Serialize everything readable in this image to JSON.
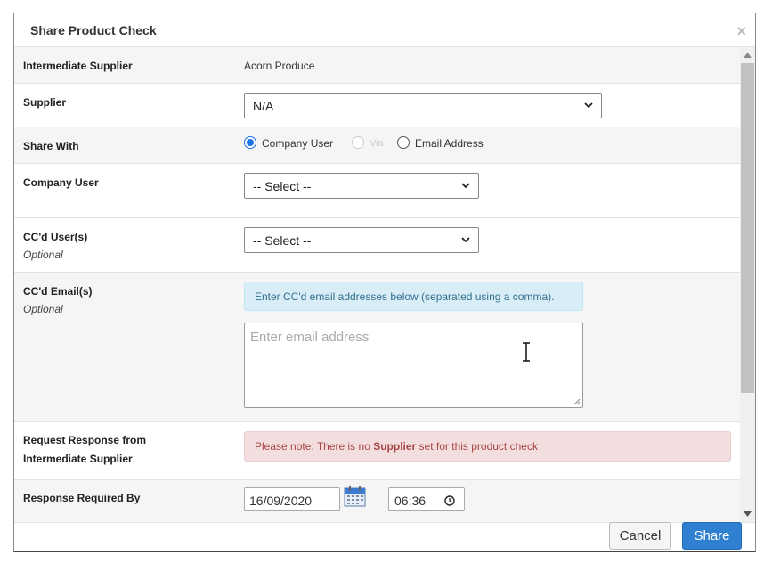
{
  "modal": {
    "title": "Share Product Check",
    "close_glyph": "×"
  },
  "rows": {
    "intermediate_supplier": {
      "label": "Intermediate Supplier",
      "value": "Acorn Produce"
    },
    "supplier": {
      "label": "Supplier",
      "selected": "N/A"
    },
    "share_with": {
      "label": "Share With",
      "options": [
        {
          "label": "Company User",
          "checked": true,
          "disabled": false
        },
        {
          "label": "Via",
          "checked": false,
          "disabled": true
        },
        {
          "label": "Email Address",
          "checked": false,
          "disabled": false
        }
      ]
    },
    "company_user": {
      "label": "Company User",
      "selected": "-- Select --"
    },
    "ccd_users": {
      "label": "CC'd User(s)",
      "sublabel": "Optional",
      "selected": "-- Select --"
    },
    "ccd_emails": {
      "label": "CC'd Email(s)",
      "sublabel": "Optional",
      "info": "Enter CC'd email addresses below (separated using a comma).",
      "placeholder": "Enter email address"
    },
    "request_response": {
      "label_line1": "Request Response from",
      "label_line2": "Intermediate Supplier",
      "note_prefix": "Please note: There is no ",
      "note_bold": "Supplier",
      "note_suffix": " set for this product check"
    },
    "response_required": {
      "label": "Response Required By",
      "date": "16/09/2020",
      "time": "06:36"
    }
  },
  "footer": {
    "cancel_label": "Cancel",
    "share_label": "Share"
  },
  "colors": {
    "primary": "#2f80d1",
    "info_bg": "#d9edf7",
    "danger_bg": "#f2dede",
    "radio_accent": "#1a73e8"
  }
}
